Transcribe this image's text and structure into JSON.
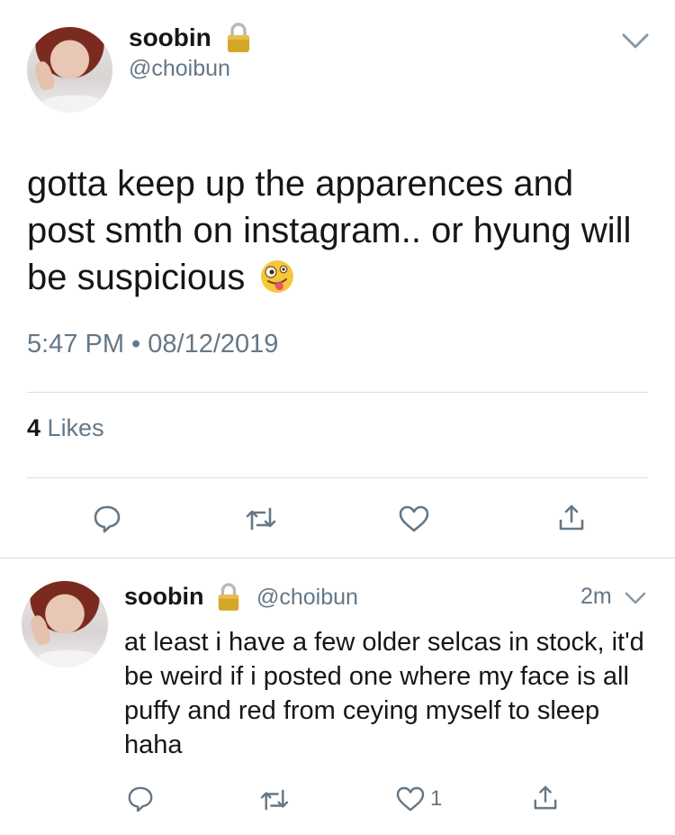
{
  "main_tweet": {
    "display_name": "soobin",
    "handle": "@choibun",
    "text": "gotta keep up the apparences and post smth on instagram.. or hyung will be suspicious",
    "emoji": "zany-face",
    "timestamp": "5:47 PM • 08/12/2019",
    "likes_count": "4",
    "likes_label": "Likes"
  },
  "reply_tweet": {
    "display_name": "soobin",
    "handle": "@choibun",
    "time_ago": "2m",
    "text": "at least i have a few older selcas in stock, it'd be weird if i posted one where my face is all puffy and red from ceying myself to sleep haha",
    "like_count": "1"
  },
  "icons": {
    "lock": "lock-icon",
    "chevron": "chevron-down-icon",
    "reply": "reply-icon",
    "retweet": "retweet-icon",
    "like": "heart-icon",
    "share": "share-icon"
  },
  "colors": {
    "text": "#14171a",
    "secondary": "#657786",
    "divider": "#d9dfe3",
    "lock_gold": "#d4a62a"
  }
}
